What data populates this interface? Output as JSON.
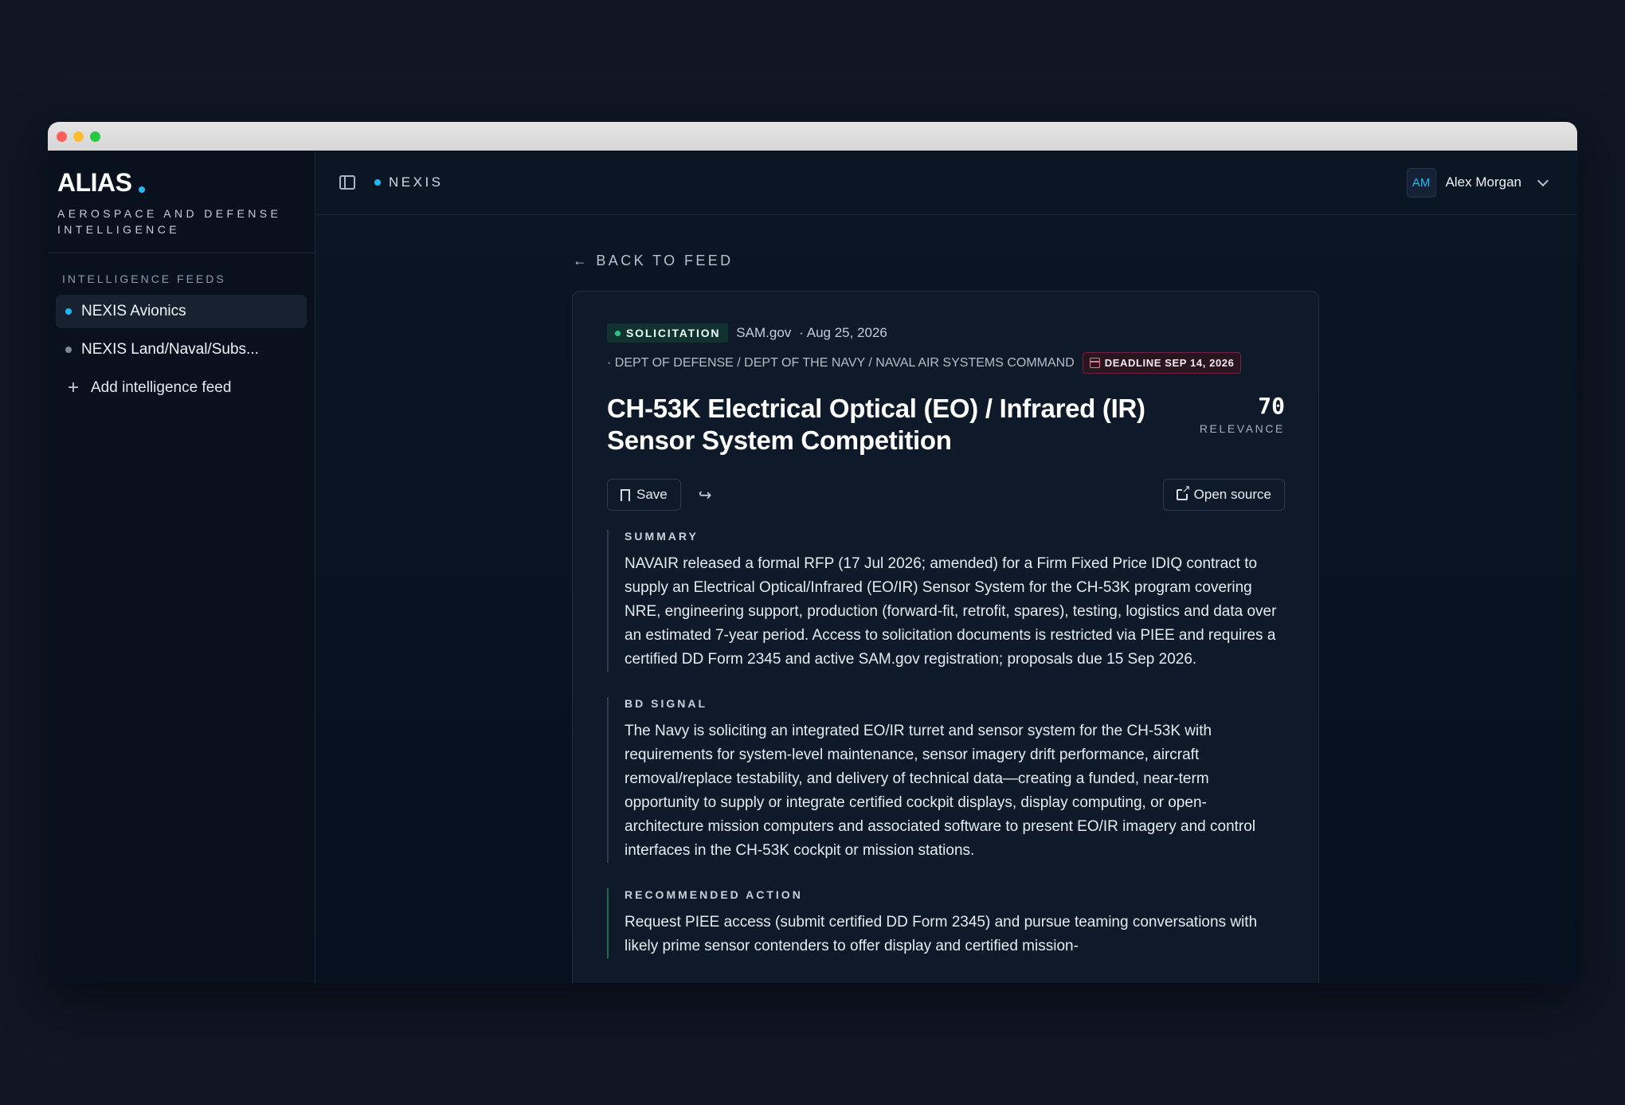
{
  "brand": {
    "name": "ALIAS",
    "tagline": "AEROSPACE AND DEFENSE INTELLIGENCE",
    "accent_color": "#22b8f0"
  },
  "sidebar": {
    "section_label": "INTELLIGENCE FEEDS",
    "feeds": [
      {
        "label": "NEXIS Avionics",
        "active": true,
        "dot_color": "#22b8f0"
      },
      {
        "label": "NEXIS Land/Naval/Subs...",
        "active": false,
        "dot_color": "#7d8898"
      }
    ],
    "add_feed_label": "Add intelligence feed"
  },
  "topbar": {
    "breadcrumb": "NEXIS",
    "user": {
      "initials": "AM",
      "name": "Alex Morgan"
    }
  },
  "back_link": "BACK TO FEED",
  "article": {
    "type_badge": "SOLICITATION",
    "source": "SAM.gov",
    "date": "· Aug 25, 2026",
    "agency": "· DEPT OF DEFENSE / DEPT OF THE NAVY / NAVAL AIR SYSTEMS COMMAND",
    "deadline": "DEADLINE SEP 14, 2026",
    "title": "CH-53K Electrical Optical (EO) / Infrared (IR) Sensor System Competition",
    "relevance_score": "70",
    "relevance_label": "RELEVANCE",
    "save_label": "Save",
    "open_source_label": "Open source",
    "sections": [
      {
        "label": "SUMMARY",
        "text": "NAVAIR released a formal RFP (17 Jul 2026; amended) for a Firm Fixed Price IDIQ contract to supply an Electrical Optical/Infrared (EO/IR) Sensor System for the CH-53K program covering NRE, engineering support, production (forward-fit, retrofit, spares), testing, logistics and data over an estimated 7-year period. Access to solicitation documents is restricted via PIEE and requires a certified DD Form 2345 and active SAM.gov registration; proposals due 15 Sep 2026."
      },
      {
        "label": "BD SIGNAL",
        "text": "The Navy is soliciting an integrated EO/IR turret and sensor system for the CH-53K with requirements for system-level maintenance, sensor imagery drift performance, aircraft removal/replace testability, and delivery of technical data—creating a funded, near-term opportunity to supply or integrate certified cockpit displays, display computing, or open-architecture mission computers and associated software to present EO/IR imagery and control interfaces in the CH-53K cockpit or mission stations."
      },
      {
        "label": "RECOMMENDED ACTION",
        "text": "Request PIEE access (submit certified DD Form 2345) and pursue teaming conversations with likely prime sensor contenders to offer display and certified mission-"
      }
    ]
  },
  "colors": {
    "background": "#0f1624",
    "window_bg": "#07111e",
    "card_bg": "#0e1a29",
    "badge_green": "#27c28a",
    "deadline_red": "#6e2434"
  }
}
